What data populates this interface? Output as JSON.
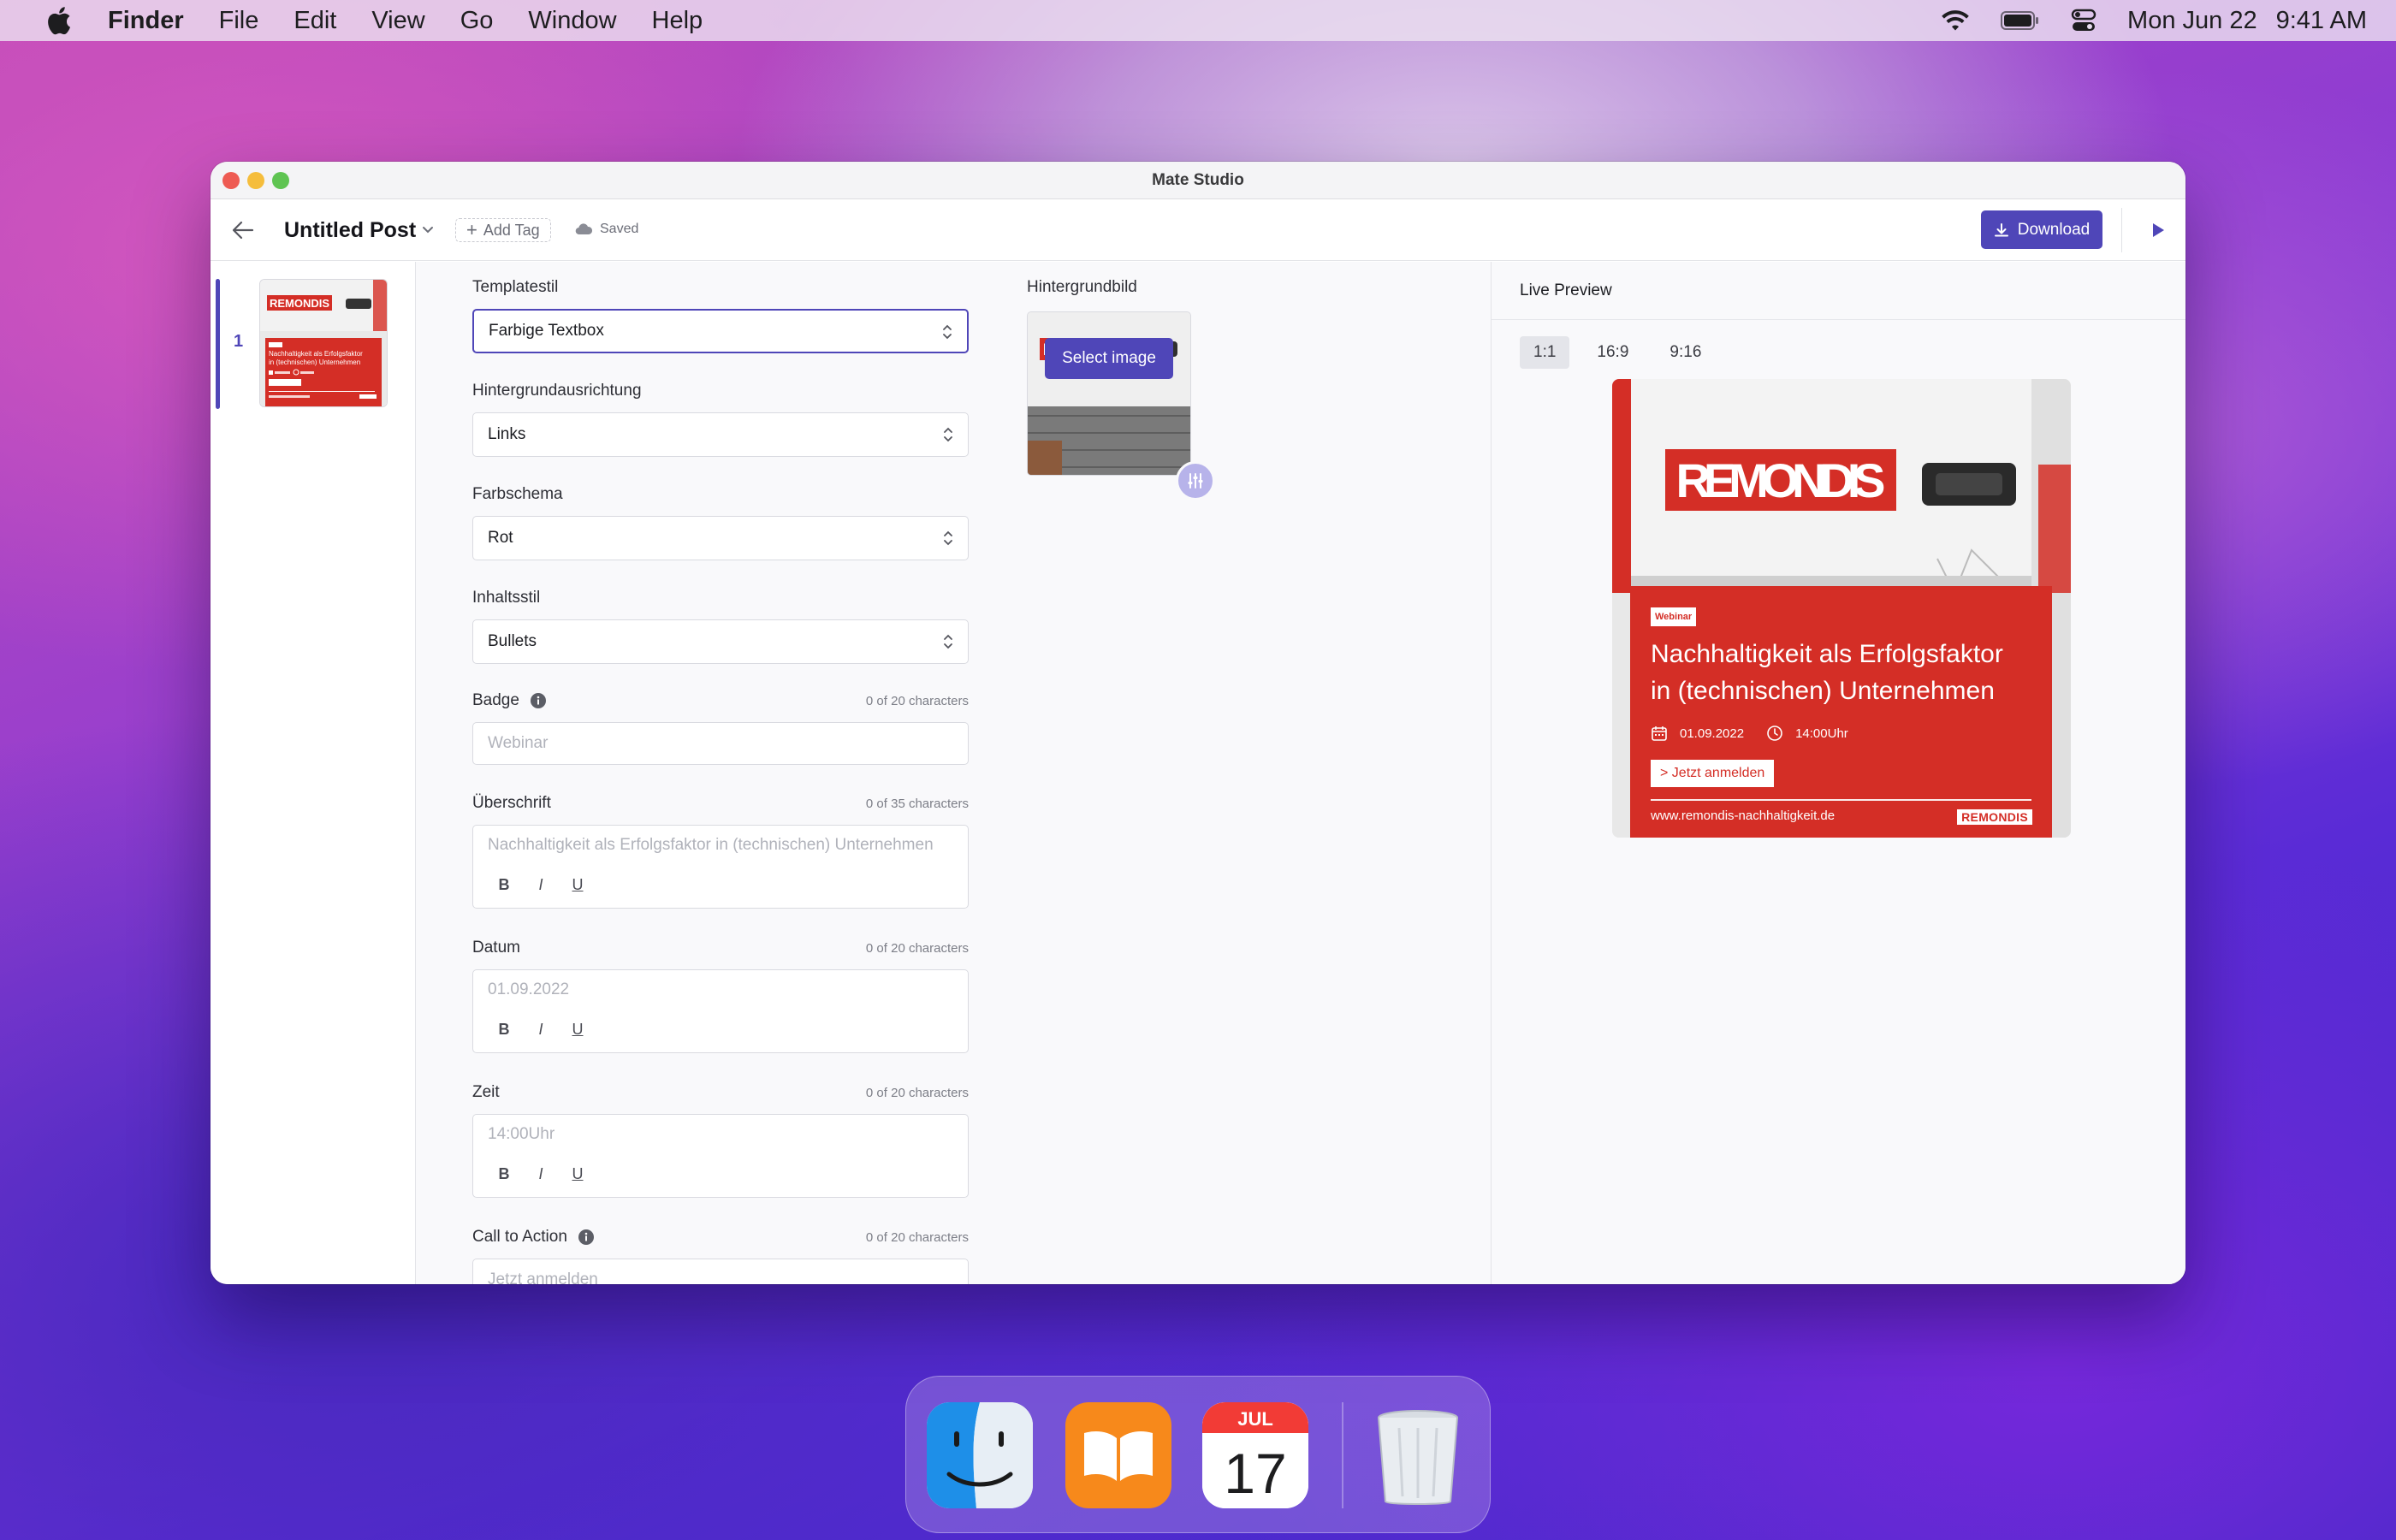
{
  "menubar": {
    "app": "Finder",
    "items": [
      "File",
      "Edit",
      "View",
      "Go",
      "Window",
      "Help"
    ],
    "date": "Mon Jun 22",
    "time": "9:41 AM",
    "status_icons": [
      "wifi-icon",
      "battery-icon",
      "control-center-icon"
    ]
  },
  "window": {
    "title": "Mate Studio"
  },
  "toolbar": {
    "post_title": "Untitled Post",
    "add_tag": "Add Tag",
    "saved": "Saved",
    "download": "Download"
  },
  "slides": [
    {
      "number": "1",
      "active": true
    }
  ],
  "form": {
    "templatestil": {
      "label": "Templatestil",
      "value": "Farbige Textbox"
    },
    "hintergrundausrichtung": {
      "label": "Hintergrundausrichtung",
      "value": "Links"
    },
    "farbschema": {
      "label": "Farbschema",
      "value": "Rot"
    },
    "inhaltsstil": {
      "label": "Inhaltsstil",
      "value": "Bullets"
    },
    "badge": {
      "label": "Badge",
      "count": "0 of 20 characters",
      "placeholder": "Webinar"
    },
    "ueberschrift": {
      "label": "Überschrift",
      "count": "0 of 35 characters",
      "placeholder": "Nachhaltigkeit als Erfolgsfaktor in (technischen) Unternehmen"
    },
    "datum": {
      "label": "Datum",
      "count": "0 of 20 characters",
      "placeholder": "01.09.2022"
    },
    "zeit": {
      "label": "Zeit",
      "count": "0 of 20 characters",
      "placeholder": "14:00Uhr"
    },
    "cta": {
      "label": "Call to Action",
      "count": "0 of 20 characters",
      "placeholder": "Jetzt anmelden"
    },
    "format": {
      "bold": "B",
      "italic": "I",
      "underline": "U"
    }
  },
  "background": {
    "label": "Hintergrundbild",
    "select_image": "Select image"
  },
  "preview": {
    "heading": "Live Preview",
    "ratios": [
      "1:1",
      "16:9",
      "9:16"
    ],
    "active_ratio": "1:1",
    "badge": "Webinar",
    "headline": "Nachhaltigkeit als Erfolgsfaktor in (technischen) Unternehmen",
    "date": "01.09.2022",
    "time": "14:00Uhr",
    "cta": "> Jetzt anmelden",
    "url": "www.remondis-nachhaltigkeit.de",
    "logo": "REMONDIS",
    "photo_sign": "REMONDIS",
    "brand_color": "#d42e26"
  },
  "thumb": {
    "sign": "REMONDIS",
    "headline": "Nachhaltigkeit als Erfolgsfaktor in (technischen) Unternehmen"
  },
  "dock": {
    "apps": [
      "finder-icon",
      "books-icon",
      "calendar-icon",
      "trash-icon"
    ],
    "calendar_month": "JUL",
    "calendar_day": "17"
  },
  "colors": {
    "accent": "#4f46b8",
    "traffic_red": "#ee5b53",
    "traffic_yellow": "#f5bd3c",
    "traffic_green": "#5fc452"
  }
}
